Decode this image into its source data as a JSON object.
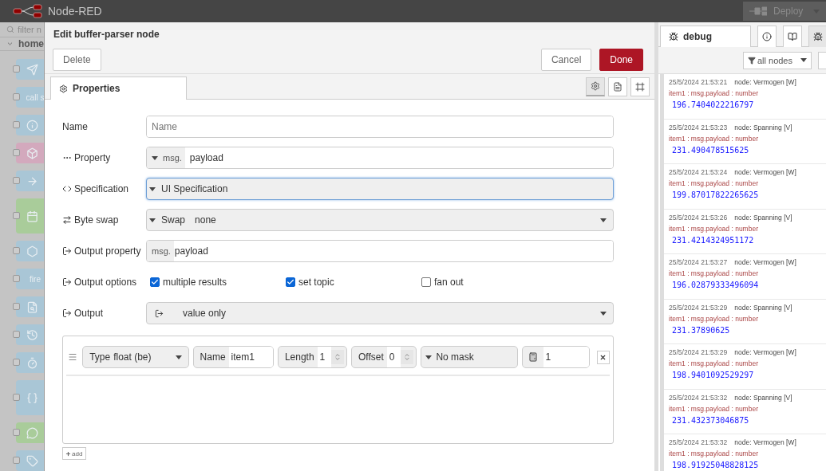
{
  "header": {
    "title": "Node-RED",
    "deploy": {
      "label": "Deploy",
      "disabled": true
    }
  },
  "palette": {
    "filter_placeholder": "filter n",
    "category": "home",
    "nodes": [
      {
        "kind": "send",
        "color": "#a9c6d6"
      },
      {
        "kind": "text",
        "label": "call s",
        "color": "#a9c6d6"
      },
      {
        "kind": "info",
        "color": "#a9c6d6"
      },
      {
        "kind": "box",
        "color": "#d3a9bd"
      },
      {
        "kind": "arrow",
        "color": "#a9c6d6"
      },
      {
        "kind": "calendar",
        "color": "#a9cc9a"
      },
      {
        "kind": "hexagon",
        "color": "#a9c6d6"
      },
      {
        "kind": "text",
        "label": "fire",
        "color": "#a9c6d6"
      },
      {
        "kind": "search",
        "color": "#a9c6d6"
      },
      {
        "kind": "history",
        "color": "#a9c6d6"
      },
      {
        "kind": "timer",
        "color": "#a9c6d6"
      },
      {
        "kind": "braces",
        "color": "#a9c6d6"
      },
      {
        "kind": "comment",
        "color": "#a9cc9a"
      },
      {
        "kind": "tag",
        "color": "#a9c6d6"
      }
    ]
  },
  "dialog": {
    "title": "Edit buffer-parser node",
    "delete": "Delete",
    "cancel": "Cancel",
    "done": "Done",
    "tabs": [
      {
        "label": "Properties",
        "selected": true
      }
    ],
    "tool_buttons": [
      {
        "kind": "gear",
        "selected": true
      },
      {
        "kind": "doc",
        "selected": false
      },
      {
        "kind": "frame",
        "selected": false
      }
    ],
    "rows": [
      {
        "kind": "text",
        "label": "Name",
        "placeholder": "Name"
      },
      {
        "kind": "typed",
        "label": "Property",
        "prefix": "msg.",
        "value": "payload"
      },
      {
        "kind": "select",
        "label": "Specification",
        "value": "UI Specification",
        "focused": true
      },
      {
        "kind": "swap",
        "label": "Byte swap",
        "prefix": "Swap",
        "value": "none"
      },
      {
        "kind": "fixed",
        "label": "Output property",
        "prefix": "msg.",
        "value": "payload"
      },
      {
        "kind": "checks",
        "label": "Output options",
        "options": [
          {
            "label": "multiple results",
            "checked": true
          },
          {
            "label": "set topic",
            "checked": true
          },
          {
            "label": "fan out",
            "checked": false
          }
        ]
      },
      {
        "kind": "output",
        "label": "Output",
        "value": "value only"
      }
    ],
    "item": {
      "type_label": "Type",
      "type_value": "float (be)",
      "name_label": "Name",
      "name_value": "item1",
      "length_label": "Length",
      "length_value": "1",
      "offset_label": "Offset",
      "offset_value": "0",
      "mask": "No mask",
      "scale": "1"
    },
    "add": "add"
  },
  "sidebar": {
    "tabs": [
      {
        "kind": "debug",
        "label": "debug",
        "selected": true
      },
      {
        "kind": "info",
        "selected": false
      },
      {
        "kind": "book",
        "selected": false
      },
      {
        "kind": "bug",
        "selected": true
      }
    ],
    "filter": "all nodes",
    "messages": [
      {
        "time": "25/5/2024 21:53:21",
        "node": "node: Vermogen [W]",
        "topic": "item1 : msg.payload : number",
        "value": "196.7404022216797"
      },
      {
        "time": "25/5/2024 21:53:23",
        "node": "node: Spanning [V]",
        "topic": "item1 : msg.payload : number",
        "value": "231.490478515625"
      },
      {
        "time": "25/5/2024 21:53:24",
        "node": "node: Vermogen [W]",
        "topic": "item1 : msg.payload : number",
        "value": "199.87017822265625"
      },
      {
        "time": "25/5/2024 21:53:26",
        "node": "node: Spanning [V]",
        "topic": "item1 : msg.payload : number",
        "value": "231.4214324951172"
      },
      {
        "time": "25/5/2024 21:53:27",
        "node": "node: Vermogen [W]",
        "topic": "item1 : msg.payload : number",
        "value": "196.02879333496094"
      },
      {
        "time": "25/5/2024 21:53:29",
        "node": "node: Spanning [V]",
        "topic": "item1 : msg.payload : number",
        "value": "231.37890625"
      },
      {
        "time": "25/5/2024 21:53:29",
        "node": "node: Vermogen [W]",
        "topic": "item1 : msg.payload : number",
        "value": "198.9401092529297"
      },
      {
        "time": "25/5/2024 21:53:32",
        "node": "node: Spanning [V]",
        "topic": "item1 : msg.payload : number",
        "value": "231.432373046875"
      },
      {
        "time": "25/5/2024 21:53:32",
        "node": "node: Vermogen [W]",
        "topic": "item1 : msg.payload : number",
        "value": "198.91925048828125"
      }
    ]
  }
}
